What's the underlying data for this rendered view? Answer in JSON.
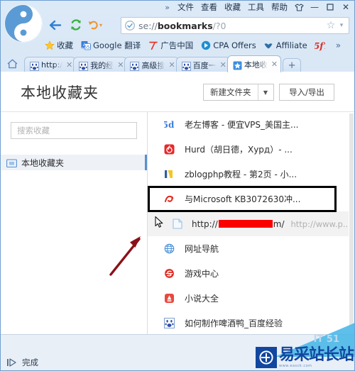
{
  "window": {
    "menu_chevron": "»",
    "menu_items": [
      "文件",
      "查看",
      "收藏",
      "工具",
      "帮助"
    ],
    "skin_icon": "shirt-icon",
    "minimize": "—",
    "maximize": "☐",
    "close": "✕"
  },
  "toolbar": {
    "logo_icon": "sogou-logo-icon",
    "back_icon": "back-arrow-icon",
    "refresh_icon": "refresh-icon",
    "undo_icon": "undo-arrow-icon",
    "undo_caret": "▾"
  },
  "address_bar": {
    "shield_icon": "shield-check-icon",
    "scheme": "se://",
    "host": "bookmarks",
    "path": "/?0",
    "star_icon": "☆",
    "caret_icon": "▾"
  },
  "bookmarks_bar": {
    "items": [
      {
        "label": "收藏",
        "icon": "star-icon"
      },
      {
        "label": "Google 翻译",
        "icon": "google-translate-icon"
      },
      {
        "label": "广告中国",
        "icon": "guang-icon"
      },
      {
        "label": "CPA Offers",
        "icon": "cpa-circle-icon"
      },
      {
        "label": "Affiliate",
        "icon": "affiliate-icon"
      },
      {
        "label": "",
        "icon": "red-script-icon"
      }
    ],
    "overflow_chevron": "»"
  },
  "tabs": {
    "home_icon": "home-icon",
    "items": [
      {
        "label": "http:/",
        "icon": "baidu-paw-icon",
        "active": false
      },
      {
        "label": "我的经",
        "icon": "baidu-paw-icon",
        "active": false
      },
      {
        "label": "高级搜",
        "icon": "baidu-paw-icon",
        "active": false
      },
      {
        "label": "百度一",
        "icon": "baidu-paw-icon",
        "active": false
      },
      {
        "label": "本地收",
        "icon": "blue-star-icon",
        "active": true
      }
    ],
    "close_glyph": "✕",
    "new_tab_glyph": "+"
  },
  "page": {
    "title": "本地收藏夹",
    "new_folder_label": "新建文件夹",
    "new_folder_caret": "▼",
    "import_export_label": "导入/导出"
  },
  "sidebar": {
    "search_placeholder": "搜索收藏",
    "items": [
      {
        "label": "本地收藏夹",
        "icon": "folder-icon",
        "selected": true
      }
    ]
  },
  "bookmark_list": {
    "rows": [
      {
        "title": "老左博客 - 便宜VPS_美国主...",
        "icon": "laozuo-icon",
        "selected": false
      },
      {
        "title": "Hurd（胡日德，Хурд）- ...",
        "icon": "netease-music-icon",
        "selected": false
      },
      {
        "title": "zblogphp教程 - 第2页 - 小...",
        "icon": "zblog-icon",
        "selected": false
      },
      {
        "title": "与Microsoft KB3072630冲...",
        "icon": "red-swirl-icon",
        "selected": false
      },
      {
        "title": "",
        "icon": "blank-page-icon",
        "selected": true,
        "url_prefix": "http://",
        "url_redacted": true,
        "url_suffix": "m/",
        "url_secondary": "http://www.p..."
      },
      {
        "title": "网址导航",
        "icon": "globe-icon",
        "selected": false
      },
      {
        "title": "游戏中心",
        "icon": "game-center-icon",
        "selected": false
      },
      {
        "title": "小说大全",
        "icon": "novel-icon",
        "selected": false
      },
      {
        "title": "如何制作啤酒鸭_百度经验",
        "icon": "baidu-paw-icon",
        "selected": false
      }
    ]
  },
  "annotations": {
    "highlight_box": "black-rectangle-highlight",
    "pointer_arrow": "red-arrow-annotation",
    "mouse_cursor": "mouse-cursor-icon"
  },
  "status_bar": {
    "nav_icon": "page-nav-icon",
    "text": "完成",
    "speaker_icon": "speaker-icon"
  },
  "watermark": {
    "text": "易采站长站",
    "subtext": "www.easck.com",
    "faint_text": "IT 51",
    "logo_glyph": "€"
  },
  "colors": {
    "accent": "#5b8ed0",
    "redaction": "#fb0000",
    "watermark": "#12479f",
    "chrome": "#cfe0f2"
  }
}
